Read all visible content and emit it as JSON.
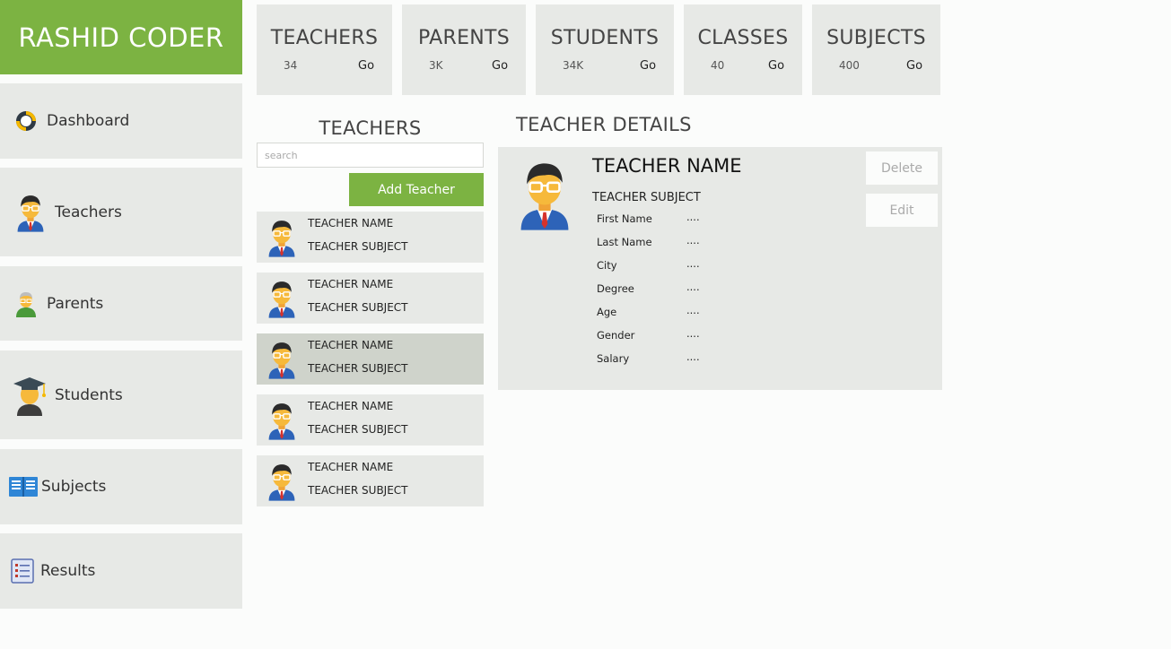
{
  "brand": "RASHID CODER",
  "sidebar": {
    "items": [
      {
        "label": "Dashboard",
        "icon": "dashboard-icon"
      },
      {
        "label": "Teachers",
        "icon": "teacher-icon"
      },
      {
        "label": "Parents",
        "icon": "parent-icon"
      },
      {
        "label": "Students",
        "icon": "student-icon"
      },
      {
        "label": "Subjects",
        "icon": "book-icon"
      },
      {
        "label": "Results",
        "icon": "checklist-icon"
      }
    ]
  },
  "stats": [
    {
      "title": "TEACHERS",
      "value": "34",
      "go": "Go"
    },
    {
      "title": "PARENTS",
      "value": "3K",
      "go": "Go"
    },
    {
      "title": "STUDENTS",
      "value": "34K",
      "go": "Go"
    },
    {
      "title": "CLASSES",
      "value": "40",
      "go": "Go"
    },
    {
      "title": "SUBJECTS",
      "value": "400",
      "go": "Go"
    }
  ],
  "teachers_panel": {
    "title": "TEACHERS",
    "search_placeholder": "search",
    "add_button": "Add Teacher",
    "list": [
      {
        "name": "TEACHER NAME",
        "subject": "TEACHER SUBJECT"
      },
      {
        "name": "TEACHER NAME",
        "subject": "TEACHER SUBJECT"
      },
      {
        "name": "TEACHER NAME",
        "subject": "TEACHER SUBJECT",
        "selected": true
      },
      {
        "name": "TEACHER NAME",
        "subject": "TEACHER SUBJECT"
      },
      {
        "name": "TEACHER NAME",
        "subject": "TEACHER SUBJECT"
      }
    ]
  },
  "details": {
    "title": "TEACHER DETAILS",
    "name": "TEACHER NAME",
    "subject": "TEACHER SUBJECT",
    "fields": [
      {
        "label": "First Name",
        "value": "...."
      },
      {
        "label": "Last Name",
        "value": "...."
      },
      {
        "label": "City",
        "value": "...."
      },
      {
        "label": "Degree",
        "value": "...."
      },
      {
        "label": "Age",
        "value": "...."
      },
      {
        "label": "Gender",
        "value": "...."
      },
      {
        "label": "Salary",
        "value": "...."
      }
    ],
    "delete_button": "Delete",
    "edit_button": "Edit"
  },
  "colors": {
    "accent": "#7cb342",
    "panel": "#e7e9e6",
    "selected": "#cfd3cb",
    "background": "#fbfcfb"
  }
}
